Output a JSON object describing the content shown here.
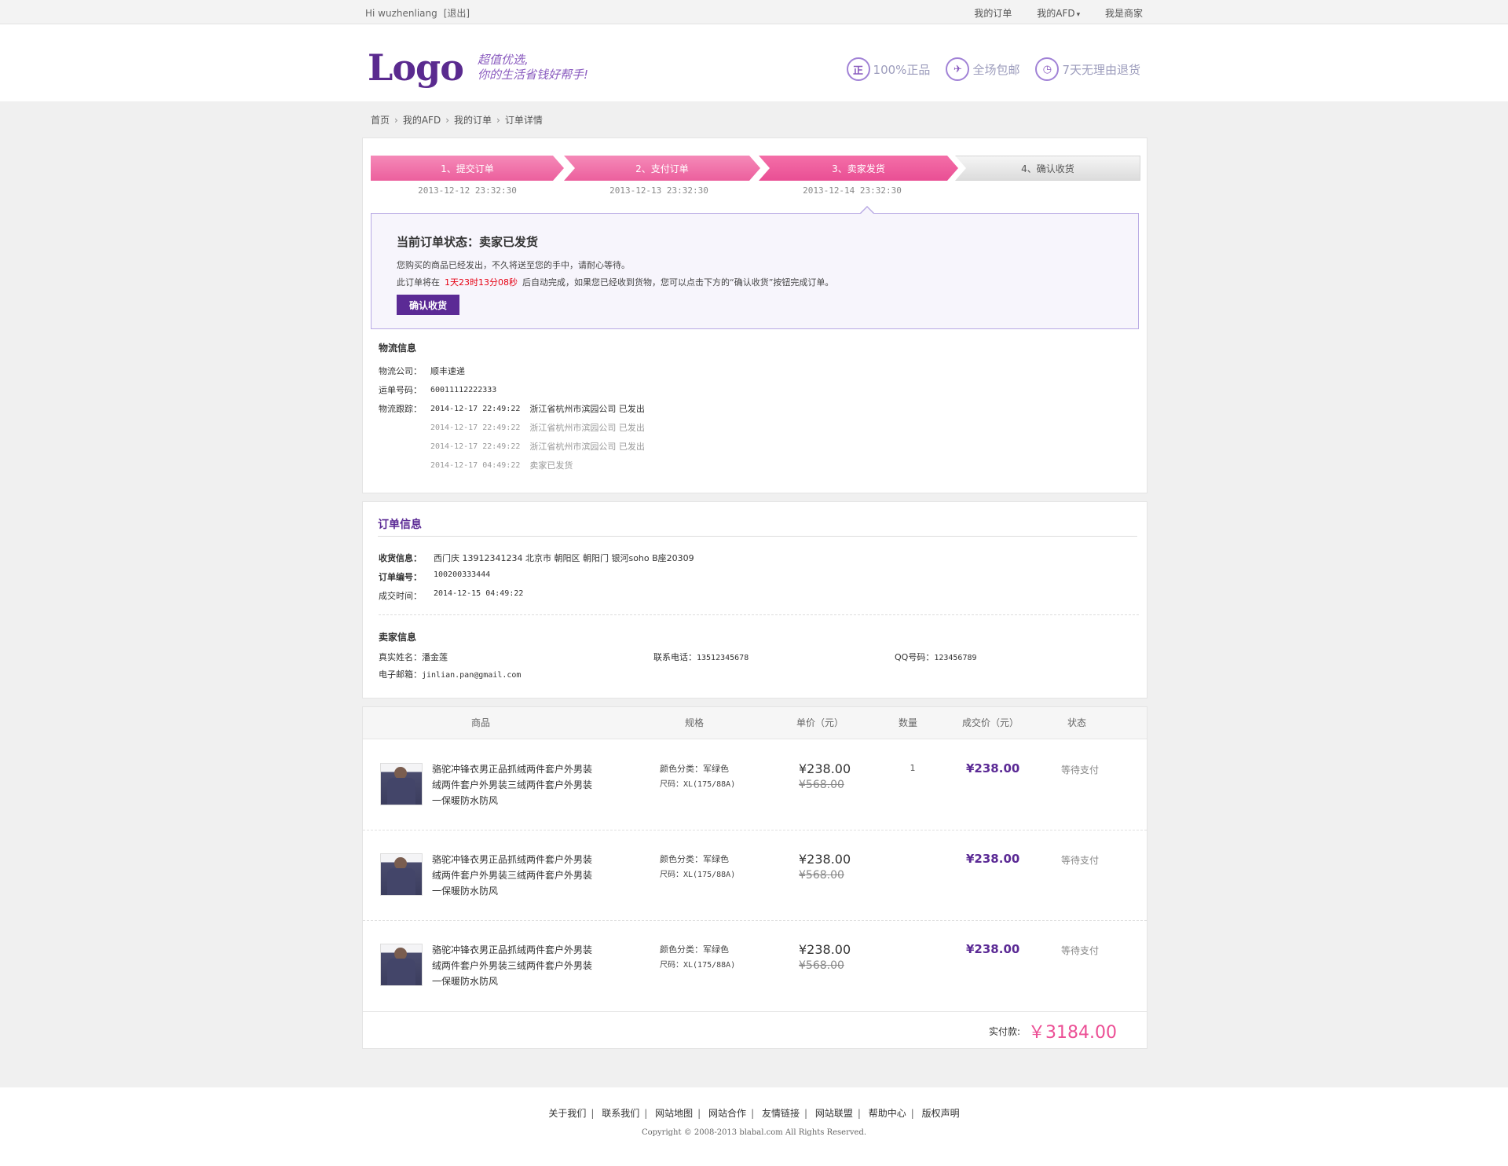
{
  "topbar": {
    "greeting": "Hi wuzhenliang",
    "logout": "[退出]",
    "nav": [
      "我的订单",
      "我的AFD",
      "我是商家"
    ]
  },
  "header": {
    "logo": "Logo",
    "slogan_line1": "超值优选,",
    "slogan_line2": "你的生活省钱好帮手!",
    "badges": [
      {
        "icon": "authentic-icon",
        "glyph": "正",
        "label": "100%正品"
      },
      {
        "icon": "free-shipping-icon",
        "glyph": "✈",
        "label": "全场包邮"
      },
      {
        "icon": "return-clock-icon",
        "glyph": "◷",
        "label": "7天无理由退货"
      }
    ]
  },
  "breadcrumb": [
    "首页",
    "我的AFD",
    "我的订单",
    "订单详情"
  ],
  "steps": [
    {
      "label": "1、提交订单",
      "date": "2013-12-12  23:32:30"
    },
    {
      "label": "2、支付订单",
      "date": "2013-12-13  23:32:30"
    },
    {
      "label": "3、卖家发货",
      "date": "2013-12-14  23:32:30"
    },
    {
      "label": "4、确认收货",
      "date": ""
    }
  ],
  "status": {
    "title": "当前订单状态：卖家已发货",
    "line1": "您购买的商品已经发出，不久将送至您的手中，请耐心等待。",
    "line2_prefix": "此订单将在",
    "countdown": "1天23时13分08秒",
    "line2_suffix": "后自动完成，如果您已经收到货物，您可以点击下方的“确认收货”按钮完成订单。",
    "button": "确认收货"
  },
  "logistics": {
    "title": "物流信息",
    "company_label": "物流公司：",
    "company": "顺丰速递",
    "waybill_label": "运单号码：",
    "waybill": "60011112222333",
    "track_label": "物流跟踪：",
    "tracks": [
      {
        "time": "2014-12-17 22:49:22",
        "text": "浙江省杭州市滨园公司 已发出"
      },
      {
        "time": "2014-12-17 22:49:22",
        "text": "浙江省杭州市滨园公司 已发出"
      },
      {
        "time": "2014-12-17 22:49:22",
        "text": "浙江省杭州市滨园公司 已发出"
      },
      {
        "time": "2014-12-17 04:49:22",
        "text": "卖家已发货"
      }
    ]
  },
  "order": {
    "title": "订单信息",
    "receiver_label": "收货信息：",
    "receiver": "西门庆  13912341234  北京市 朝阳区 朝阳门  银河soho B座20309",
    "order_no_label": "订单编号：",
    "order_no": "100200333444",
    "deal_time_label": "成交时间：",
    "deal_time": "2014-12-15 04:49:22",
    "seller_title": "卖家信息",
    "name_label": "真实姓名：",
    "name": "潘金莲",
    "phone_label": "联系电话：",
    "phone": "13512345678",
    "qq_label": "QQ号码：",
    "qq": "123456789",
    "email_label": "电子邮箱：",
    "email": "jinlian.pan@gmail.com"
  },
  "items_table": {
    "headers": [
      "商品",
      "规格",
      "单价（元）",
      "数量",
      "成交价（元）",
      "状态"
    ],
    "items": [
      {
        "name": "骆驼冲锋衣男正品抓绒两件套户外男装绒两件套户外男装三绒两件套户外男装一保暖防水防风",
        "color": "颜色分类：军绿色",
        "size": "尺码：XL(175/88A)",
        "price": "¥238.00",
        "orig": "¥568.00",
        "qty": "1",
        "deal": "¥238.00",
        "status": "等待支付"
      },
      {
        "name": "骆驼冲锋衣男正品抓绒两件套户外男装绒两件套户外男装三绒两件套户外男装一保暖防水防风",
        "color": "颜色分类：军绿色",
        "size": "尺码：XL(175/88A)",
        "price": "¥238.00",
        "orig": "¥568.00",
        "qty": "",
        "deal": "¥238.00",
        "status": "等待支付"
      },
      {
        "name": "骆驼冲锋衣男正品抓绒两件套户外男装绒两件套户外男装三绒两件套户外男装一保暖防水防风",
        "color": "颜色分类：军绿色",
        "size": "尺码：XL(175/88A)",
        "price": "¥238.00",
        "orig": "¥568.00",
        "qty": "",
        "deal": "¥238.00",
        "status": "等待支付"
      }
    ],
    "total_label": "实付款:",
    "total": "￥3184.00"
  },
  "footer": {
    "links": [
      "关于我们",
      "联系我们",
      "网站地图",
      "网站合作",
      "友情链接",
      "网站联盟",
      "帮助中心",
      "版权声明"
    ],
    "copyright": "Copyright © 2008-2013 blabal.com All Rights Reserved."
  }
}
